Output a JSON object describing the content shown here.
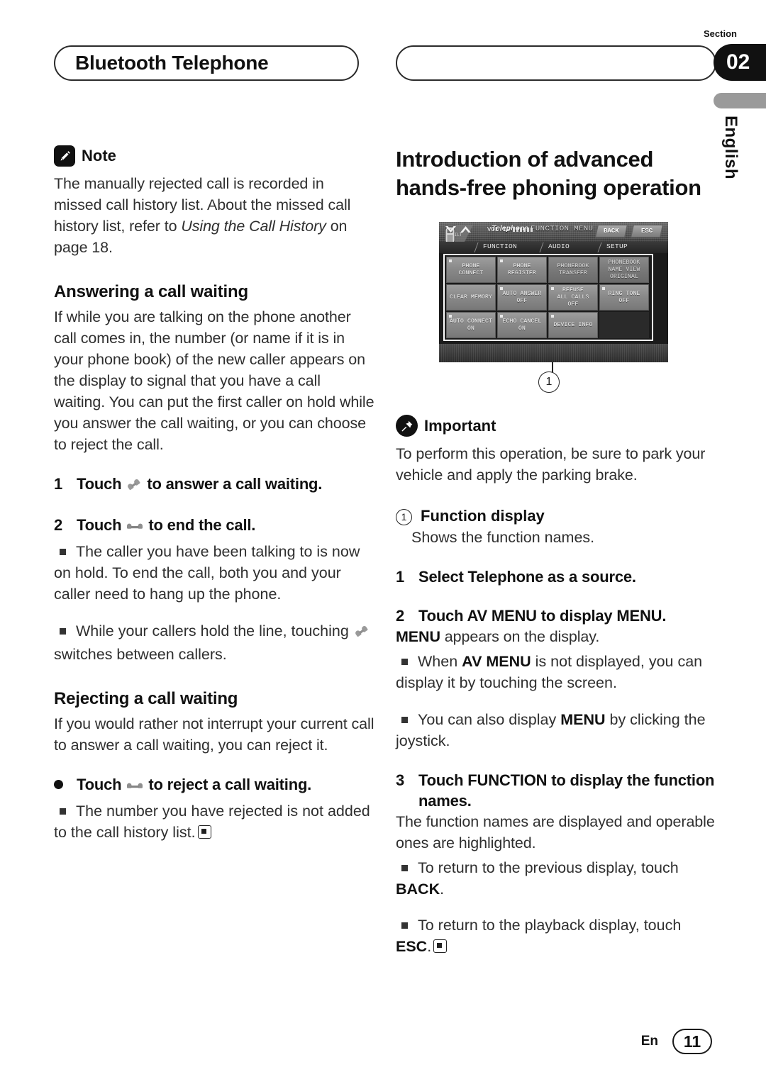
{
  "header": {
    "left_pill_title": "Bluetooth Telephone",
    "right_pill_title": "",
    "section_label": "Section",
    "section_number": "02",
    "language_tab": "English"
  },
  "left_column": {
    "note": {
      "label": "Note",
      "text_1": "The manually rejected call is recorded in missed call history list. About the missed call history list, refer to ",
      "text_italic": "Using the Call History",
      "text_2": " on page 18."
    },
    "answering": {
      "heading": "Answering a call waiting",
      "paragraph": "If while you are talking on the phone another call comes in, the number (or name if it is in your phone book) of the new caller appears on the display to signal that you have a call waiting. You can put the first caller on hold while you answer the call waiting, or you can choose to reject the call.",
      "step1_num": "1",
      "step1_pre": "Touch",
      "step1_post": "to answer a call waiting.",
      "step2_num": "2",
      "step2_pre": "Touch",
      "step2_post": "to end the call.",
      "bullet1": "The caller you have been talking to is now on hold. To end the call, both you and your caller need to hang up the phone.",
      "bullet2_pre": "While your callers hold the line, touching",
      "bullet2_post": "switches between callers."
    },
    "rejecting": {
      "heading": "Rejecting a call waiting",
      "paragraph": "If you would rather not interrupt your current call to answer a call waiting, you can reject it.",
      "bullet_step_pre": "Touch",
      "bullet_step_post": "to reject a call waiting.",
      "bullet1_pre": "The number you have rejected is not added to the call history list."
    }
  },
  "right_column": {
    "heading": "Introduction of advanced hands-free phoning operation",
    "important": {
      "label": "Important",
      "text": "To perform this operation, be sure to park your vehicle and apply the parking brake."
    },
    "callout_number": "1",
    "function_display": {
      "marker": "1",
      "title": "Function display",
      "text": "Shows the function names."
    },
    "steps": [
      {
        "num": "1",
        "title": "Select Telephone as a source."
      },
      {
        "num": "2",
        "title": "Touch AV MENU to display MENU.",
        "body_bold_1": "MENU",
        "body_rest_1": " appears on the display.",
        "bullet1_pre": "When ",
        "bullet1_bold": "AV MENU",
        "bullet1_post": " is not displayed, you can display it by touching the screen.",
        "bullet2_pre": "You can also display ",
        "bullet2_bold": "MENU",
        "bullet2_post": " by clicking the joystick."
      },
      {
        "num": "3",
        "title": "Touch FUNCTION to display the function names.",
        "body": "The function names are displayed and operable ones are highlighted.",
        "bullet1_pre": "To return to the previous display, touch ",
        "bullet1_bold": "BACK",
        "bullet1_post": ".",
        "bullet2_pre": "To return to the playback display, touch ",
        "bullet2_bold": "ESC",
        "bullet2_post": "."
      }
    ]
  },
  "device_screen": {
    "title_italic": "Telephone",
    "title_rest": "FUNCTION MENU",
    "tabs": [
      "FUNCTION",
      "AUDIO",
      "SETUP"
    ],
    "buttons": [
      {
        "lines": [
          "PHONE",
          "CONNECT"
        ],
        "led": true,
        "dim": false
      },
      {
        "lines": [
          "PHONE",
          "REGISTER"
        ],
        "led": true,
        "dim": false
      },
      {
        "lines": [
          "PHONEBOOK",
          "TRANSFER"
        ],
        "led": false,
        "dim": true
      },
      {
        "lines": [
          "PHONEBOOK",
          "NAME VIEW",
          "ORIGINAL"
        ],
        "led": false,
        "dim": true
      },
      {
        "lines": [
          "CLEAR MEMORY"
        ],
        "led": false,
        "dim": false
      },
      {
        "lines": [
          "AUTO ANSWER",
          "OFF"
        ],
        "led": true,
        "dim": false
      },
      {
        "lines": [
          "REFUSE",
          "ALL CALLS",
          "OFF"
        ],
        "led": true,
        "dim": false
      },
      {
        "lines": [
          "RING TONE",
          "OFF"
        ],
        "led": true,
        "dim": false
      },
      {
        "lines": [
          "AUTO CONNECT",
          "ON"
        ],
        "led": true,
        "dim": false
      },
      {
        "lines": [
          "ECHO CANCEL",
          "ON"
        ],
        "led": true,
        "dim": false
      },
      {
        "lines": [
          "DEVICE INFO"
        ],
        "led": true,
        "dim": false
      },
      {
        "lines": [
          ""
        ],
        "led": false,
        "dim": false,
        "empty": true
      }
    ],
    "tilt_label": "TILT",
    "volume_label": "VOL.12",
    "softkey_back": "BACK",
    "softkey_esc": "ESC"
  },
  "footer": {
    "language_code": "En",
    "page_number": "11"
  }
}
